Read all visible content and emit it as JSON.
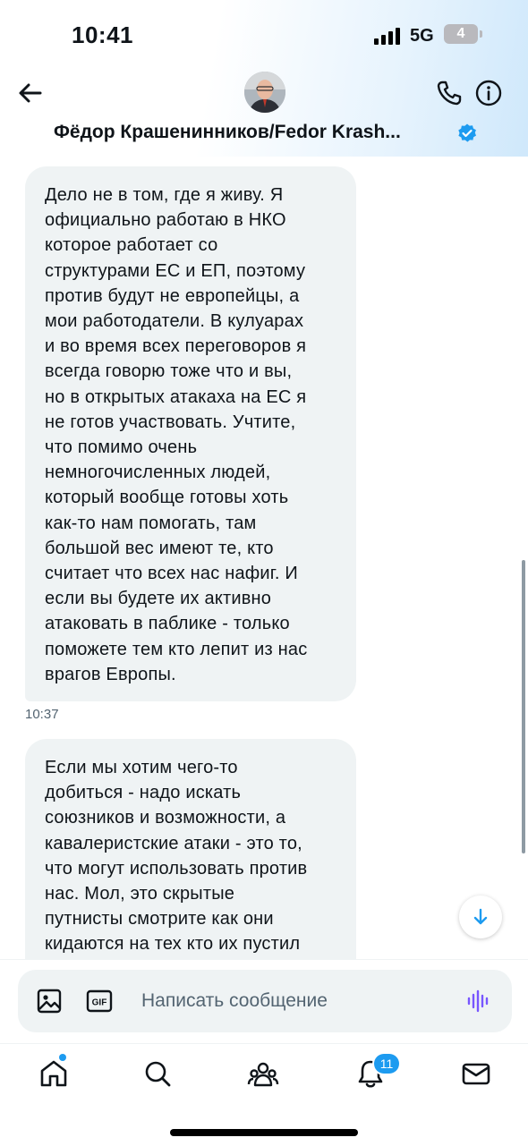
{
  "status_bar": {
    "time": "10:41",
    "network": "5G",
    "battery": "4"
  },
  "header": {
    "contact_name": "Фёдор Крашенинников/Fedor Krash...",
    "verified": true,
    "icons": [
      "back-arrow-icon",
      "phone-icon",
      "info-icon",
      "verified-badge-icon"
    ]
  },
  "messages": [
    {
      "text": "Дело не в том, где я живу. Я\nофициально работаю в НКО\nкоторое работает со\nструктурами ЕС и ЕП, поэтому\nпротив будут не европейцы, а\nмои работодатели. В кулуарах\nи во время всех переговоров я\nвсегда говорю тоже что и вы,\nно в открытых атакаха на ЕС я\nне готов участвовать. Учтите,\nчто помимо очень\nнемногочисленных людей,\nкоторый вообще готовы хоть\nкак-то нам помогать, там\nбольшой вес имеют те, кто\nсчитает что всех нас нафиг. И\nесли вы будете их активно\nатаковать в паблике - только\nпоможете тем кто лепит из нас\nврагов Европы.",
      "time": "10:37"
    },
    {
      "text": "Если мы хотим чего-то\nдобиться - надо искать\nсоюзников и возможности, а\nкавалеристские атаки - это то,\nчто могут использовать против\nнас. Мол, это скрытые\nпутнисты смотрите как они\nкидаются на тех  кто их пустил",
      "time": ""
    }
  ],
  "composer": {
    "placeholder": "Написать сообщение",
    "value": "",
    "icons": [
      "image-icon",
      "gif-icon",
      "voice-waveform-icon"
    ]
  },
  "bottom_nav": {
    "items": [
      "home-icon",
      "search-icon",
      "communities-icon",
      "notifications-icon",
      "messages-icon"
    ],
    "notifications_badge": "11"
  },
  "colors": {
    "accent": "#1d9bf0",
    "bubble": "#eff3f4",
    "text": "#0f1419",
    "secondary": "#536471",
    "voice": "#7856ff"
  }
}
